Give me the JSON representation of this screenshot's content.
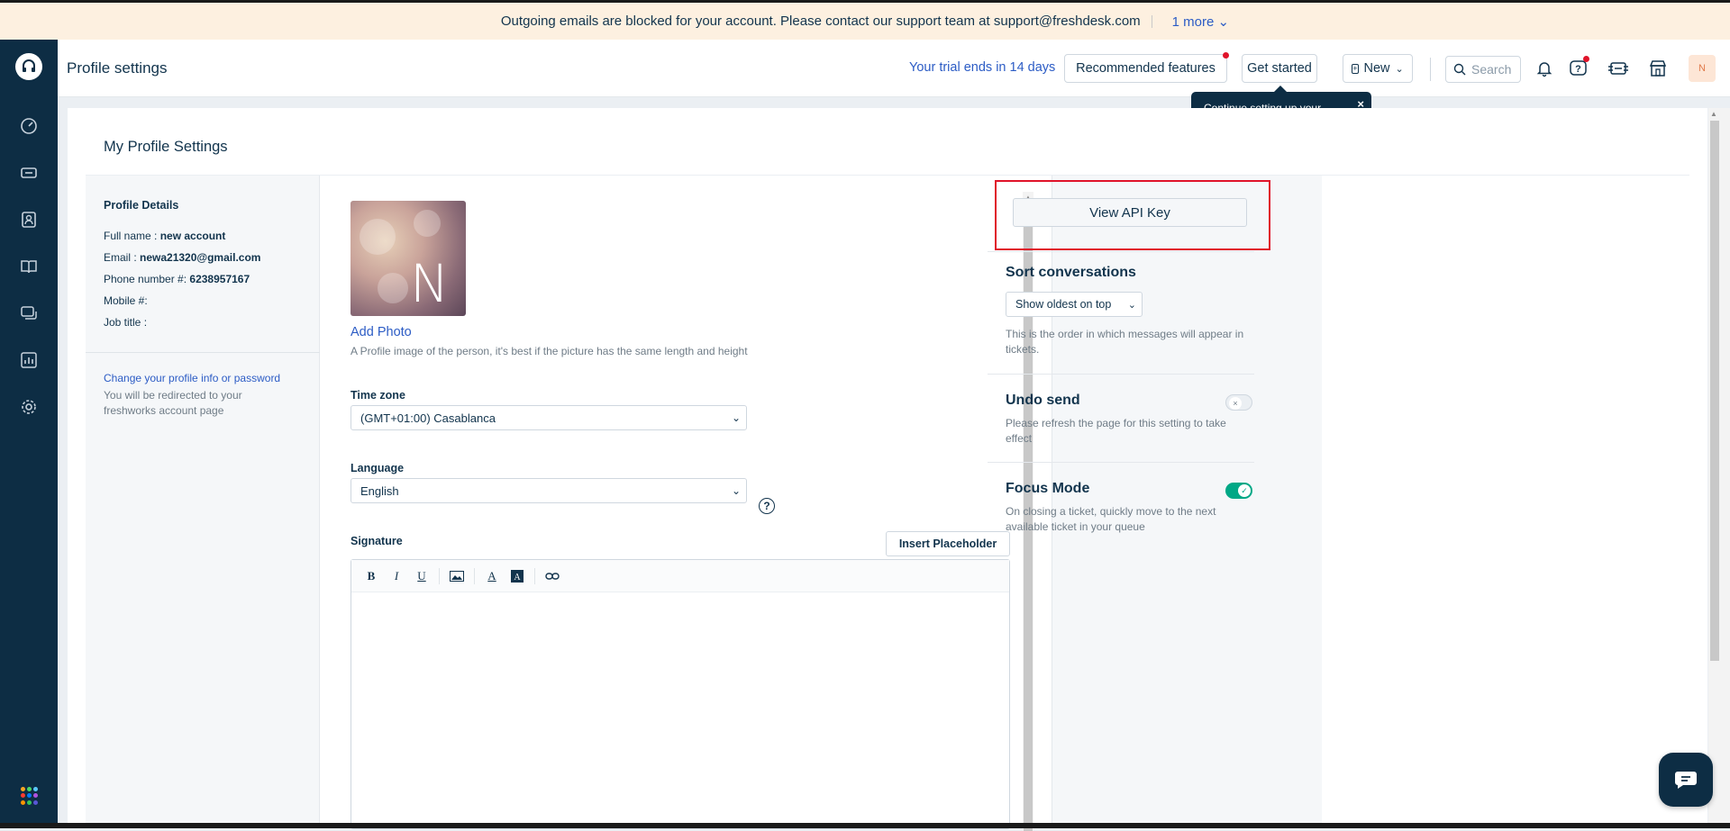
{
  "banner": {
    "message": "Outgoing emails are blocked for your account. Please contact our support team at support@freshdesk.com",
    "more_label": "1 more"
  },
  "header": {
    "title": "Profile settings",
    "trial_text": "Your trial ends in 14 days",
    "recommended_label": "Recommended features",
    "get_started_label": "Get started",
    "new_label": "New",
    "search_placeholder": "Search",
    "avatar_initial": "N"
  },
  "tooltip": {
    "text": "Continue setting up your account",
    "close": "×"
  },
  "page": {
    "title": "My Profile Settings"
  },
  "profile_details": {
    "heading": "Profile Details",
    "full_name_label": "Full name : ",
    "full_name": "new account",
    "email_label": "Email : ",
    "email": "newa21320@gmail.com",
    "phone_label": "Phone number #: ",
    "phone": "6238957167",
    "mobile_label": "Mobile #:",
    "job_title_label": "Job title :",
    "change_link": "Change your profile info or password",
    "redirect_note": "You will be redirected to your freshworks account page"
  },
  "photo": {
    "initial": "N",
    "add_label": "Add Photo",
    "hint": "A Profile image of the person, it's best if the picture has the same length and height"
  },
  "timezone": {
    "label": "Time zone",
    "value": "(GMT+01:00) Casablanca"
  },
  "language": {
    "label": "Language",
    "value": "English"
  },
  "signature": {
    "label": "Signature",
    "insert_placeholder_label": "Insert Placeholder",
    "toolbar": [
      "B",
      "I",
      "U",
      "image",
      "A",
      "A-bg",
      "link"
    ]
  },
  "api": {
    "button_label": "View API Key"
  },
  "sort": {
    "heading": "Sort conversations",
    "value": "Show oldest on top",
    "desc": "This is the order in which messages will appear in tickets."
  },
  "undo_send": {
    "heading": "Undo send",
    "desc": "Please refresh the page for this setting to take effect",
    "enabled": false
  },
  "focus_mode": {
    "heading": "Focus Mode",
    "desc": "On closing a ticket, quickly move to the next available ticket in your queue",
    "enabled": true
  },
  "colors": {
    "nav": "#0d2d44",
    "accent_link": "#2c5cc5",
    "toggle_on": "#00a886",
    "highlight": "#e0142a",
    "banner_bg": "#fdf0e0"
  }
}
